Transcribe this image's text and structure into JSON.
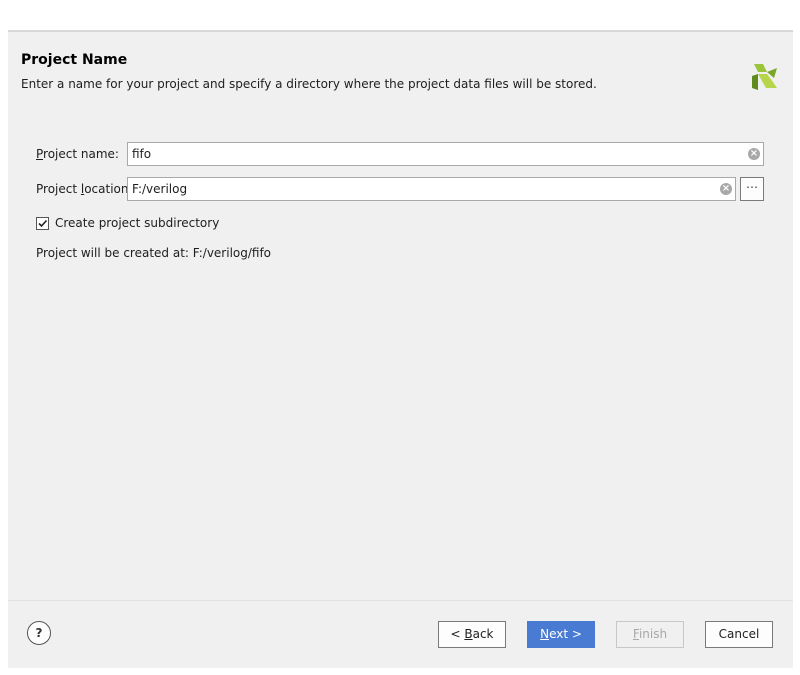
{
  "header": {
    "title": "Project Name",
    "subtitle": "Enter a name for your project and specify a directory where the project data files will be stored."
  },
  "form": {
    "project_name_label_prefix": "P",
    "project_name_label_rest": "roject name:",
    "project_name_value": "fifo",
    "project_location_label_prefix": "Project ",
    "project_location_label_key": "l",
    "project_location_label_rest": "ocation:",
    "project_location_value": "F:/verilog",
    "browse_label": "⋯",
    "create_subdir_label": "Create project subdirectory",
    "create_subdir_checked": true,
    "created_at_text": "Project will be created at: F:/verilog/fifo"
  },
  "footer": {
    "help_label": "?",
    "back_prefix": "< ",
    "back_key": "B",
    "back_rest": "ack",
    "next_key": "N",
    "next_rest": "ext >",
    "finish_key": "F",
    "finish_rest": "inish",
    "cancel_label": "Cancel"
  },
  "colors": {
    "primary_button": "#4a7bd2",
    "dialog_background": "#f0f0f0",
    "logo_green": "#8dbf2e",
    "logo_dark": "#5a7a1a"
  },
  "icons": {
    "logo": "vivado-logo-icon",
    "clear": "clear-icon",
    "check": "check-icon",
    "help": "help-icon"
  }
}
